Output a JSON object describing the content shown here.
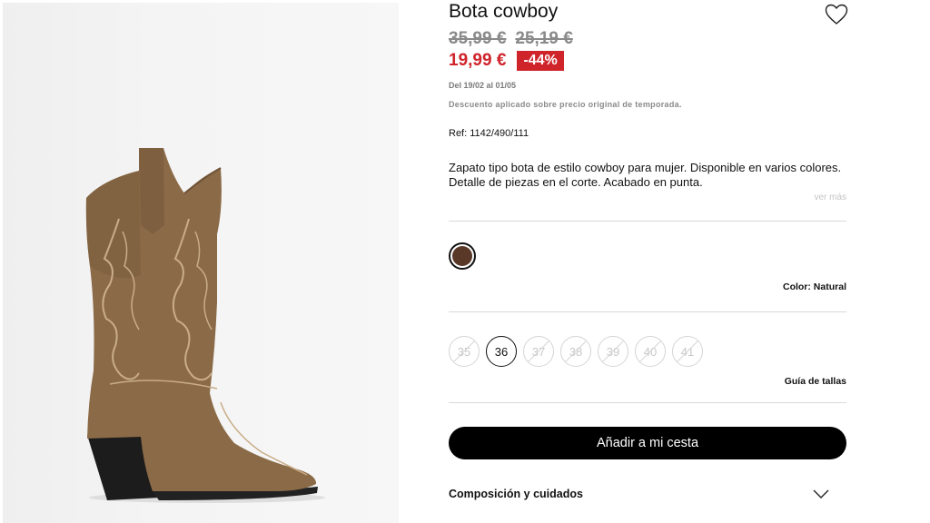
{
  "product": {
    "title": "Bota cowboy",
    "old_prices": [
      "35,99 €",
      "25,19 €"
    ],
    "price": "19,99 €",
    "discount": "-44%",
    "dates": "Del 19/02 al 01/05",
    "discount_note": "Descuento aplicado sobre precio original de temporada.",
    "ref": "Ref: 1142/490/111",
    "description": "Zapato tipo bota de estilo cowboy para mujer. Disponible en varios colores. Detalle de piezas en el corte. Acabado en punta.",
    "see_more": "ver más"
  },
  "color": {
    "label": "Color: Natural",
    "swatch_hex": "#5a3828"
  },
  "sizes": {
    "options": [
      {
        "label": "35",
        "available": false,
        "selected": false
      },
      {
        "label": "36",
        "available": true,
        "selected": true
      },
      {
        "label": "37",
        "available": false,
        "selected": false
      },
      {
        "label": "38",
        "available": false,
        "selected": false
      },
      {
        "label": "39",
        "available": false,
        "selected": false
      },
      {
        "label": "40",
        "available": false,
        "selected": false
      },
      {
        "label": "41",
        "available": false,
        "selected": false
      }
    ],
    "guide": "Guía de tallas"
  },
  "actions": {
    "add_to_cart": "Añadir a mi cesta"
  },
  "accordion": {
    "label": "Composición y cuidados"
  },
  "icons": {
    "favorite": "heart-icon",
    "expand": "chevron-down-icon"
  },
  "colors": {
    "sale_red": "#d0242b",
    "button_black": "#000000",
    "boot_tan": "#8b6a47"
  }
}
